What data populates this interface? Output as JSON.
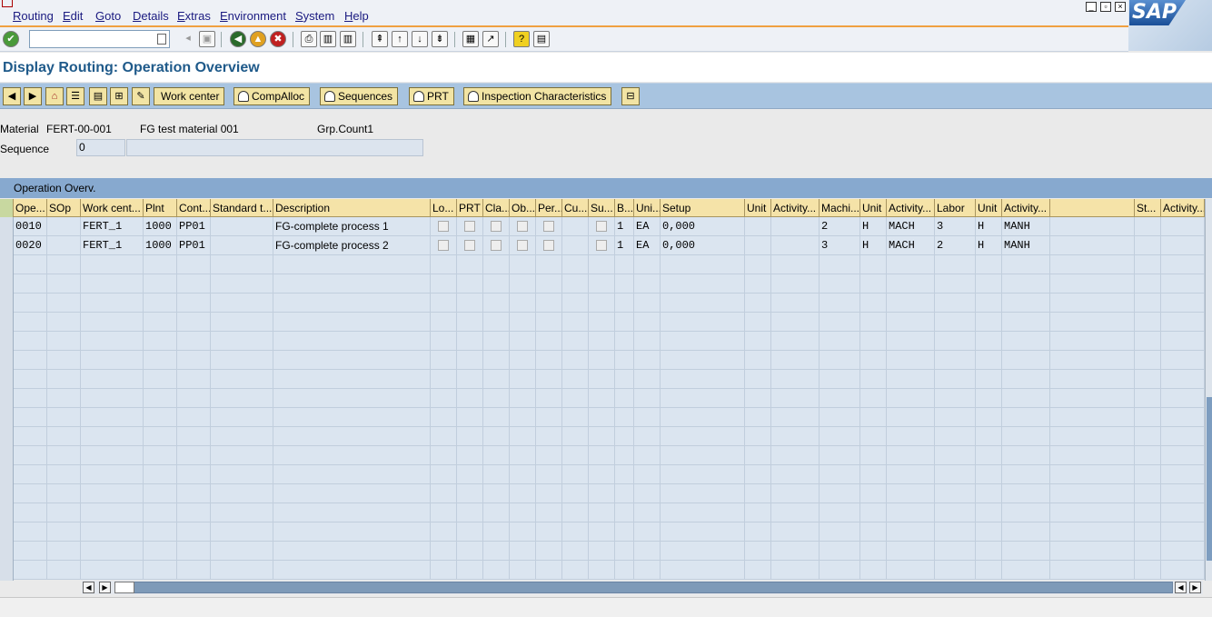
{
  "menu": [
    "Routing",
    "Edit",
    "Goto",
    "Details",
    "Extras",
    "Environment",
    "System",
    "Help"
  ],
  "logo": {
    "text": "SAP"
  },
  "toolbar": {
    "command_value": ""
  },
  "page_title": "Display Routing: Operation Overview",
  "app_toolbar": {
    "work_center": "Work center",
    "comp_alloc": "CompAlloc",
    "sequences": "Sequences",
    "prt": "PRT",
    "inspection": "Inspection Characteristics"
  },
  "header": {
    "material_label": "Material",
    "material_value": "FERT-00-001",
    "material_desc": "FG test material 001",
    "grp_count_label": "Grp.Count1",
    "sequence_label": "Sequence",
    "sequence_value": "0",
    "sequence_desc": ""
  },
  "table": {
    "title": "Operation Overv.",
    "columns": [
      "Ope...",
      "SOp",
      "Work cent...",
      "Plnt",
      "Cont...",
      "Standard t...",
      "Description",
      "Lo...",
      "PRT",
      "Cla...",
      "Ob...",
      "Per...",
      "Cu...",
      "Su...",
      "B...",
      "Uni...",
      "Setup",
      "Unit",
      "Activity...",
      "Machi...",
      "Unit",
      "Activity...",
      "Labor",
      "Unit",
      "Activity...",
      "",
      "St...",
      "Activity..."
    ],
    "rows": [
      {
        "op": "0010",
        "sop": "",
        "work_center": "FERT_1",
        "plant": "1000",
        "control": "PP01",
        "std_text": "",
        "description": "FG-complete process 1",
        "base": "1",
        "unit": "EA",
        "setup": "0,000",
        "setup_unit": "",
        "setup_activity": "",
        "machine": "2",
        "machine_unit": "H",
        "machine_activity": "MACH",
        "labor": "3",
        "labor_unit": "H",
        "labor_activity": "MANH"
      },
      {
        "op": "0020",
        "sop": "",
        "work_center": "FERT_1",
        "plant": "1000",
        "control": "PP01",
        "std_text": "",
        "description": "FG-complete process 2",
        "base": "1",
        "unit": "EA",
        "setup": "0,000",
        "setup_unit": "",
        "setup_activity": "",
        "machine": "3",
        "machine_unit": "H",
        "machine_activity": "MACH",
        "labor": "2",
        "labor_unit": "H",
        "labor_activity": "MANH"
      }
    ]
  }
}
